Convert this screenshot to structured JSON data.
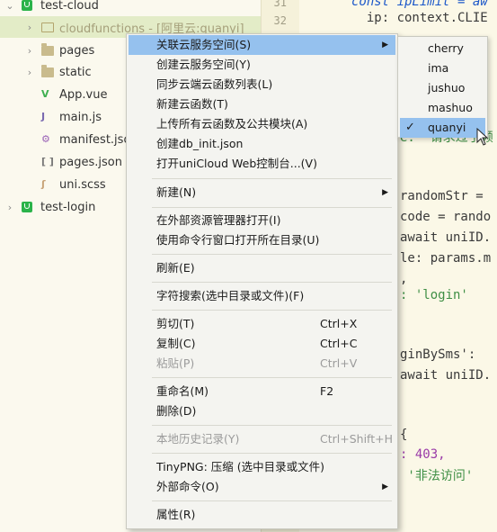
{
  "tree": {
    "items": [
      {
        "label": "test-cloud",
        "kind": "project",
        "arrow": "⌄"
      },
      {
        "label": "cloudfunctions - [阿里云:quanyi]",
        "kind": "cloud-folder",
        "arrow": "›"
      },
      {
        "label": "pages",
        "kind": "folder",
        "arrow": "›"
      },
      {
        "label": "static",
        "kind": "folder",
        "arrow": "›"
      },
      {
        "label": "App.vue",
        "kind": "vue"
      },
      {
        "label": "main.js",
        "kind": "js"
      },
      {
        "label": "manifest.json",
        "kind": "manifest"
      },
      {
        "label": "pages.json",
        "kind": "json"
      },
      {
        "label": "uni.scss",
        "kind": "scss"
      },
      {
        "label": "test-login",
        "kind": "project",
        "arrow": "›"
      }
    ]
  },
  "editor": {
    "line_numbers": [
      "31",
      "32"
    ],
    "lines": [
      "const ipLimit = aw",
      "  ip: context.CLIE",
      "",
      "",
      "",
      "",
      "e: '请求过于频",
      "",
      "",
      "randomStr = ",
      "code = rando",
      "await uniID.",
      "le: params.m",
      ",",
      ": 'login'",
      "",
      "",
      "ginBySms':",
      "await uniID.",
      "",
      "",
      "{",
      ": 403,",
      " '非法访问'"
    ]
  },
  "context_menu": {
    "items": [
      {
        "label": "关联云服务空间(S)",
        "submenu": true,
        "highlight": true
      },
      {
        "label": "创建云服务空间(Y)"
      },
      {
        "label": "同步云端云函数列表(L)"
      },
      {
        "label": "新建云函数(T)"
      },
      {
        "label": "上传所有云函数及公共模块(A)"
      },
      {
        "label": "创建db_init.json"
      },
      {
        "label": "打开uniCloud Web控制台...(V)"
      },
      {
        "label": "新建(N)",
        "submenu": true
      },
      {
        "label": "在外部资源管理器打开(I)"
      },
      {
        "label": "使用命令行窗口打开所在目录(U)"
      },
      {
        "label": "刷新(E)"
      },
      {
        "label": "字符搜索(选中目录或文件)(F)"
      },
      {
        "label": "剪切(T)",
        "shortcut": "Ctrl+X"
      },
      {
        "label": "复制(C)",
        "shortcut": "Ctrl+C"
      },
      {
        "label": "粘贴(P)",
        "shortcut": "Ctrl+V",
        "disabled": true
      },
      {
        "label": "重命名(M)",
        "shortcut": "F2"
      },
      {
        "label": "删除(D)"
      },
      {
        "label": "本地历史记录(Y)",
        "shortcut": "Ctrl+Shift+H",
        "disabled": true
      },
      {
        "label": "TinyPNG: 压缩 (选中目录或文件)"
      },
      {
        "label": "外部命令(O)",
        "submenu": true
      },
      {
        "label": "属性(R)"
      }
    ],
    "submenu_arrow": "▶"
  },
  "submenu": {
    "items": [
      {
        "label": "cherry"
      },
      {
        "label": "ima"
      },
      {
        "label": "jushuo"
      },
      {
        "label": "mashuo"
      },
      {
        "label": "quanyi",
        "checked": true,
        "highlight": true
      }
    ],
    "check_glyph": "✓"
  },
  "colors": {
    "highlight": "#95c1ee",
    "selected_row": "#e3ecc7",
    "project_icon": "#2bb34a",
    "keyword": "#1b57c9",
    "string": "#3f8f45",
    "number": "#9a3ba8"
  }
}
